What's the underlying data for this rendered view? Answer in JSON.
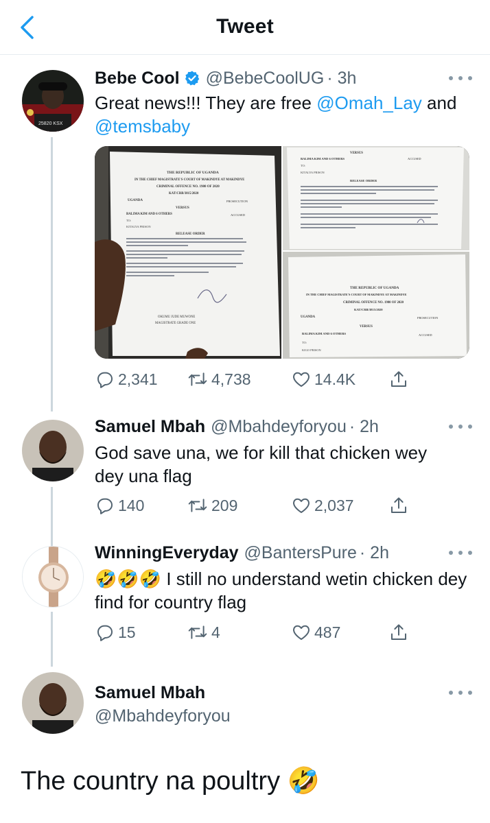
{
  "header": {
    "title": "Tweet"
  },
  "tweets": [
    {
      "name": "Bebe Cool",
      "handle": "@BebeCoolUG",
      "time": "· 3h",
      "text_plain": "Great news!!! They are free ",
      "mention1": "@Omah_Lay",
      "text_and": " and",
      "mention2": "@temsbaby",
      "replies": "2,341",
      "retweets": "4,738",
      "likes": "14.4K",
      "media": {
        "left_doc": {
          "republic": "THE REPUBLIC OF UGANDA",
          "court": "IN THE CHIEF MAGISTRATE'S COURT OF MAKINDYE AT MAKINDYE",
          "criminal": "CRIMINAL OFFENCE NO. 1980 OF 2020",
          "kat": "KAT/CRB/3815/2020",
          "uganda": "UGANDA",
          "prosecution": "PROSECUTION",
          "versus": "VERSUS",
          "balima": "BALIMA KIM AND 6 OTHERS",
          "accused": "ACCUSED",
          "to": "TO:",
          "prison": "KITALYA PRISON",
          "release": "RELEASE ORDER",
          "sign": "OKUMU JUDE MUWONE",
          "grade": "MAGISTRATE GRADE ONE"
        },
        "top_right_doc": {
          "versus": "VERSUS",
          "balima": "BALIMA KIM AND 6 OTHERS",
          "accused": "ACCUSED",
          "to": "TO:",
          "prison": "KITALYA PRISON",
          "release": "RELEASE ORDER"
        },
        "bottom_right_doc": {
          "republic": "THE REPUBLIC OF UGANDA",
          "court": "IN THE CHIEF MAGISTRATE'S COURT OF MAKINDYE AT MAKINDYE",
          "criminal": "CRIMINAL OFFENCE NO. 1980 OF 2020",
          "kat": "KAT/CRB/3815/2020",
          "uganda": "UGANDA",
          "prosecution": "PROSECUTION",
          "versus": "VERSUS",
          "balima": "BALIMA KIM AND 6 OTHERS",
          "accused": "ACCUSED",
          "to": "TO:",
          "prison": "KIGO PRISON"
        }
      }
    },
    {
      "name": "Samuel Mbah",
      "handle": "@Mbahdeyforyou",
      "time": "· 2h",
      "text": "God save una, we for kill that chicken wey dey una flag",
      "replies": "140",
      "retweets": "209",
      "likes": "2,037"
    },
    {
      "name": "WinningEveryday",
      "handle": "@BantersPure",
      "time": "· 2h",
      "emojis": "🤣🤣🤣",
      "text": "I still no understand wetin chicken dey find for country flag",
      "replies": "15",
      "retweets": "4",
      "likes": "487"
    }
  ],
  "main_tweet": {
    "name": "Samuel Mbah",
    "handle": "@Mbahdeyforyou",
    "text": "The country na poultry",
    "emoji": "🤣"
  },
  "colors": {
    "accent": "#1d9bf0",
    "secondary_text": "#536471",
    "thread_line": "#ccd6dd"
  },
  "icons": [
    "back-chevron-icon",
    "verified-badge-icon",
    "more-icon",
    "reply-icon",
    "retweet-icon",
    "like-icon",
    "share-icon"
  ]
}
